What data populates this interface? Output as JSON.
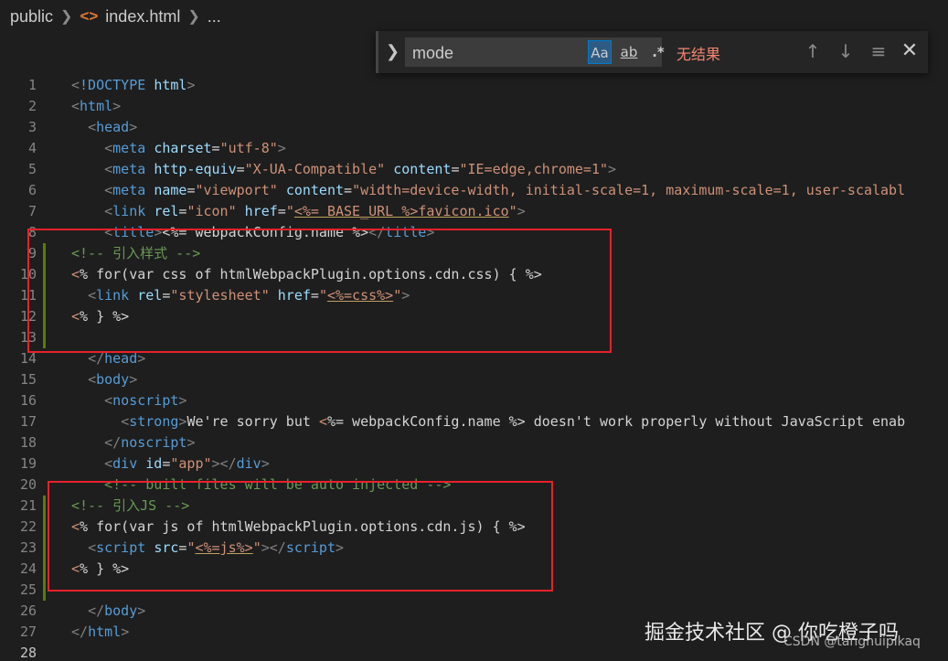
{
  "breadcrumb": {
    "folder": "public",
    "file": "index.html",
    "more": "..."
  },
  "find": {
    "value": "mode",
    "match_case": "Aa",
    "whole_word": "ab",
    "regex": ".*",
    "result": "无结果"
  },
  "lines": [
    {
      "n": "1",
      "t": [
        [
          "br",
          "<"
        ],
        [
          "tag",
          "!DOCTYPE"
        ],
        [
          "txt",
          " "
        ],
        [
          "attr",
          "html"
        ],
        [
          "br",
          ">"
        ]
      ]
    },
    {
      "n": "2",
      "t": [
        [
          "br",
          "<"
        ],
        [
          "tag",
          "html"
        ],
        [
          "br",
          ">"
        ]
      ]
    },
    {
      "n": "3",
      "t": [
        [
          "txt",
          "  "
        ],
        [
          "br",
          "<"
        ],
        [
          "tag",
          "head"
        ],
        [
          "br",
          ">"
        ]
      ]
    },
    {
      "n": "4",
      "t": [
        [
          "txt",
          "    "
        ],
        [
          "br",
          "<"
        ],
        [
          "tag",
          "meta"
        ],
        [
          "txt",
          " "
        ],
        [
          "attr",
          "charset"
        ],
        [
          "txt",
          "="
        ],
        [
          "str",
          "\"utf-8\""
        ],
        [
          "br",
          ">"
        ]
      ]
    },
    {
      "n": "5",
      "t": [
        [
          "txt",
          "    "
        ],
        [
          "br",
          "<"
        ],
        [
          "tag",
          "meta"
        ],
        [
          "txt",
          " "
        ],
        [
          "attr",
          "http-equiv"
        ],
        [
          "txt",
          "="
        ],
        [
          "str",
          "\"X-UA-Compatible\""
        ],
        [
          "txt",
          " "
        ],
        [
          "attr",
          "content"
        ],
        [
          "txt",
          "="
        ],
        [
          "str",
          "\"IE=edge,chrome=1\""
        ],
        [
          "br",
          ">"
        ]
      ]
    },
    {
      "n": "6",
      "t": [
        [
          "txt",
          "    "
        ],
        [
          "br",
          "<"
        ],
        [
          "tag",
          "meta"
        ],
        [
          "txt",
          " "
        ],
        [
          "attr",
          "name"
        ],
        [
          "txt",
          "="
        ],
        [
          "str",
          "\"viewport\""
        ],
        [
          "txt",
          " "
        ],
        [
          "attr",
          "content"
        ],
        [
          "txt",
          "="
        ],
        [
          "str",
          "\"width=device-width, initial-scale=1, maximum-scale=1, user-scalabl"
        ]
      ]
    },
    {
      "n": "7",
      "t": [
        [
          "txt",
          "    "
        ],
        [
          "br",
          "<"
        ],
        [
          "tag",
          "link"
        ],
        [
          "txt",
          " "
        ],
        [
          "attr",
          "rel"
        ],
        [
          "txt",
          "="
        ],
        [
          "str",
          "\"icon\""
        ],
        [
          "txt",
          " "
        ],
        [
          "attr",
          "href"
        ],
        [
          "txt",
          "="
        ],
        [
          "str",
          "\""
        ],
        [
          "stru",
          "<%= BASE_URL %>"
        ],
        [
          "stru",
          "favicon.ico"
        ],
        [
          "str",
          "\""
        ],
        [
          "br",
          ">"
        ]
      ]
    },
    {
      "n": "8",
      "t": [
        [
          "txt",
          "    "
        ],
        [
          "br",
          "<"
        ],
        [
          "tag",
          "title"
        ],
        [
          "br",
          ">"
        ],
        [
          "txt",
          "<%= webpackConfig.name %>"
        ],
        [
          "br",
          "</"
        ],
        [
          "tag",
          "title"
        ],
        [
          "br",
          ">"
        ]
      ]
    },
    {
      "n": "9",
      "t": [
        [
          "com",
          "<!-- 引入样式 -->"
        ]
      ]
    },
    {
      "n": "10",
      "t": [
        [
          "str",
          "<"
        ],
        [
          "ejs",
          "% for(var css of htmlWebpackPlugin.options.cdn.css) { %>"
        ]
      ]
    },
    {
      "n": "11",
      "t": [
        [
          "txt",
          "  "
        ],
        [
          "br",
          "<"
        ],
        [
          "tag",
          "link"
        ],
        [
          "txt",
          " "
        ],
        [
          "attr",
          "rel"
        ],
        [
          "txt",
          "="
        ],
        [
          "str",
          "\"stylesheet\""
        ],
        [
          "txt",
          " "
        ],
        [
          "attr",
          "href"
        ],
        [
          "txt",
          "="
        ],
        [
          "str",
          "\""
        ],
        [
          "stru",
          "<%=css%>"
        ],
        [
          "str",
          "\""
        ],
        [
          "br",
          ">"
        ]
      ]
    },
    {
      "n": "12",
      "t": [
        [
          "str",
          "<"
        ],
        [
          "ejs",
          "% } %>"
        ]
      ]
    },
    {
      "n": "13",
      "t": []
    },
    {
      "n": "14",
      "t": [
        [
          "txt",
          "  "
        ],
        [
          "br",
          "</"
        ],
        [
          "tag",
          "head"
        ],
        [
          "br",
          ">"
        ]
      ]
    },
    {
      "n": "15",
      "t": [
        [
          "txt",
          "  "
        ],
        [
          "br",
          "<"
        ],
        [
          "tag",
          "body"
        ],
        [
          "br",
          ">"
        ]
      ]
    },
    {
      "n": "16",
      "t": [
        [
          "txt",
          "    "
        ],
        [
          "br",
          "<"
        ],
        [
          "tag",
          "noscript"
        ],
        [
          "br",
          ">"
        ]
      ]
    },
    {
      "n": "17",
      "t": [
        [
          "txt",
          "      "
        ],
        [
          "br",
          "<"
        ],
        [
          "tag",
          "strong"
        ],
        [
          "br",
          ">"
        ],
        [
          "txt",
          "We're sorry but "
        ],
        [
          "str",
          "<"
        ],
        [
          "txt",
          "%= webpackConfig.name %> doesn't work properly without JavaScript enab"
        ]
      ]
    },
    {
      "n": "18",
      "t": [
        [
          "txt",
          "    "
        ],
        [
          "br",
          "</"
        ],
        [
          "tag",
          "noscript"
        ],
        [
          "br",
          ">"
        ]
      ]
    },
    {
      "n": "19",
      "t": [
        [
          "txt",
          "    "
        ],
        [
          "br",
          "<"
        ],
        [
          "tag",
          "div"
        ],
        [
          "txt",
          " "
        ],
        [
          "attr",
          "id"
        ],
        [
          "txt",
          "="
        ],
        [
          "str",
          "\"app\""
        ],
        [
          "br",
          "></"
        ],
        [
          "tag",
          "div"
        ],
        [
          "br",
          ">"
        ]
      ]
    },
    {
      "n": "20",
      "t": [
        [
          "txt",
          "    "
        ],
        [
          "com",
          "<!-- built files will be auto injected -->"
        ]
      ]
    },
    {
      "n": "21",
      "t": [
        [
          "com",
          "<!-- 引入JS -->"
        ]
      ]
    },
    {
      "n": "22",
      "t": [
        [
          "str",
          "<"
        ],
        [
          "ejs",
          "% for(var js of htmlWebpackPlugin.options.cdn.js) { %>"
        ]
      ]
    },
    {
      "n": "23",
      "t": [
        [
          "txt",
          "  "
        ],
        [
          "br",
          "<"
        ],
        [
          "tag",
          "script"
        ],
        [
          "txt",
          " "
        ],
        [
          "attr",
          "src"
        ],
        [
          "txt",
          "="
        ],
        [
          "str",
          "\""
        ],
        [
          "stru",
          "<%=js%>"
        ],
        [
          "str",
          "\""
        ],
        [
          "br",
          "></"
        ],
        [
          "tag",
          "script"
        ],
        [
          "br",
          ">"
        ]
      ]
    },
    {
      "n": "24",
      "t": [
        [
          "str",
          "<"
        ],
        [
          "ejs",
          "% } %>"
        ]
      ]
    },
    {
      "n": "25",
      "t": []
    },
    {
      "n": "26",
      "t": [
        [
          "txt",
          "  "
        ],
        [
          "br",
          "</"
        ],
        [
          "tag",
          "body"
        ],
        [
          "br",
          ">"
        ]
      ]
    },
    {
      "n": "27",
      "t": [
        [
          "br",
          "</"
        ],
        [
          "tag",
          "html"
        ],
        [
          "br",
          ">"
        ]
      ]
    },
    {
      "n": "28",
      "t": []
    }
  ],
  "watermark": "掘金技术社区 @ 你吃橙子吗",
  "csdn": "CSDN @tanghuipikaq",
  "colors": {
    "background": "#1e1e1e",
    "highlight_box": "#e8212a",
    "git_added": "#587c0c",
    "no_result": "#f48771"
  }
}
